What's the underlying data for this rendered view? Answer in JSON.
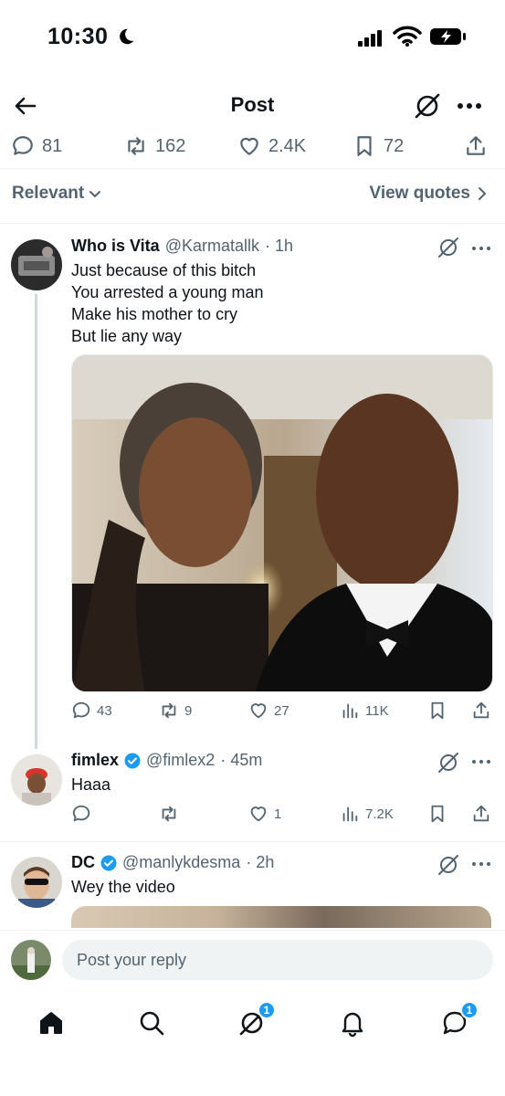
{
  "status_bar": {
    "time": "10:30"
  },
  "header": {
    "title": "Post"
  },
  "engagement": {
    "replies": "81",
    "reposts": "162",
    "likes": "2.4K",
    "bookmarks": "72"
  },
  "sort": {
    "label": "Relevant",
    "quotes_label": "View quotes"
  },
  "tweets": [
    {
      "name": "Who is Vita",
      "handle": "@Karmatallk",
      "time": "· 1h",
      "lines": [
        "Just because of this bitch",
        "You arrested a young man",
        "Make his mother to cry",
        "But lie any way"
      ],
      "replies": "43",
      "reposts": "9",
      "likes": "27",
      "views": "11K"
    },
    {
      "name": "fimlex",
      "handle": "@fimlex2",
      "time": "· 45m",
      "lines": [
        "Haaa"
      ],
      "replies": "",
      "reposts": "",
      "likes": "1",
      "views": "7.2K"
    },
    {
      "name": "DC",
      "handle": "@manlykdesma",
      "time": "· 2h",
      "lines": [
        "Wey the video"
      ]
    }
  ],
  "reply": {
    "placeholder": "Post your reply"
  },
  "nav": {
    "grok_badge": "1",
    "messages_badge": "1"
  },
  "colors": {
    "accent": "#1d9bf0",
    "text": "#0f1419",
    "secondary": "#536471"
  }
}
